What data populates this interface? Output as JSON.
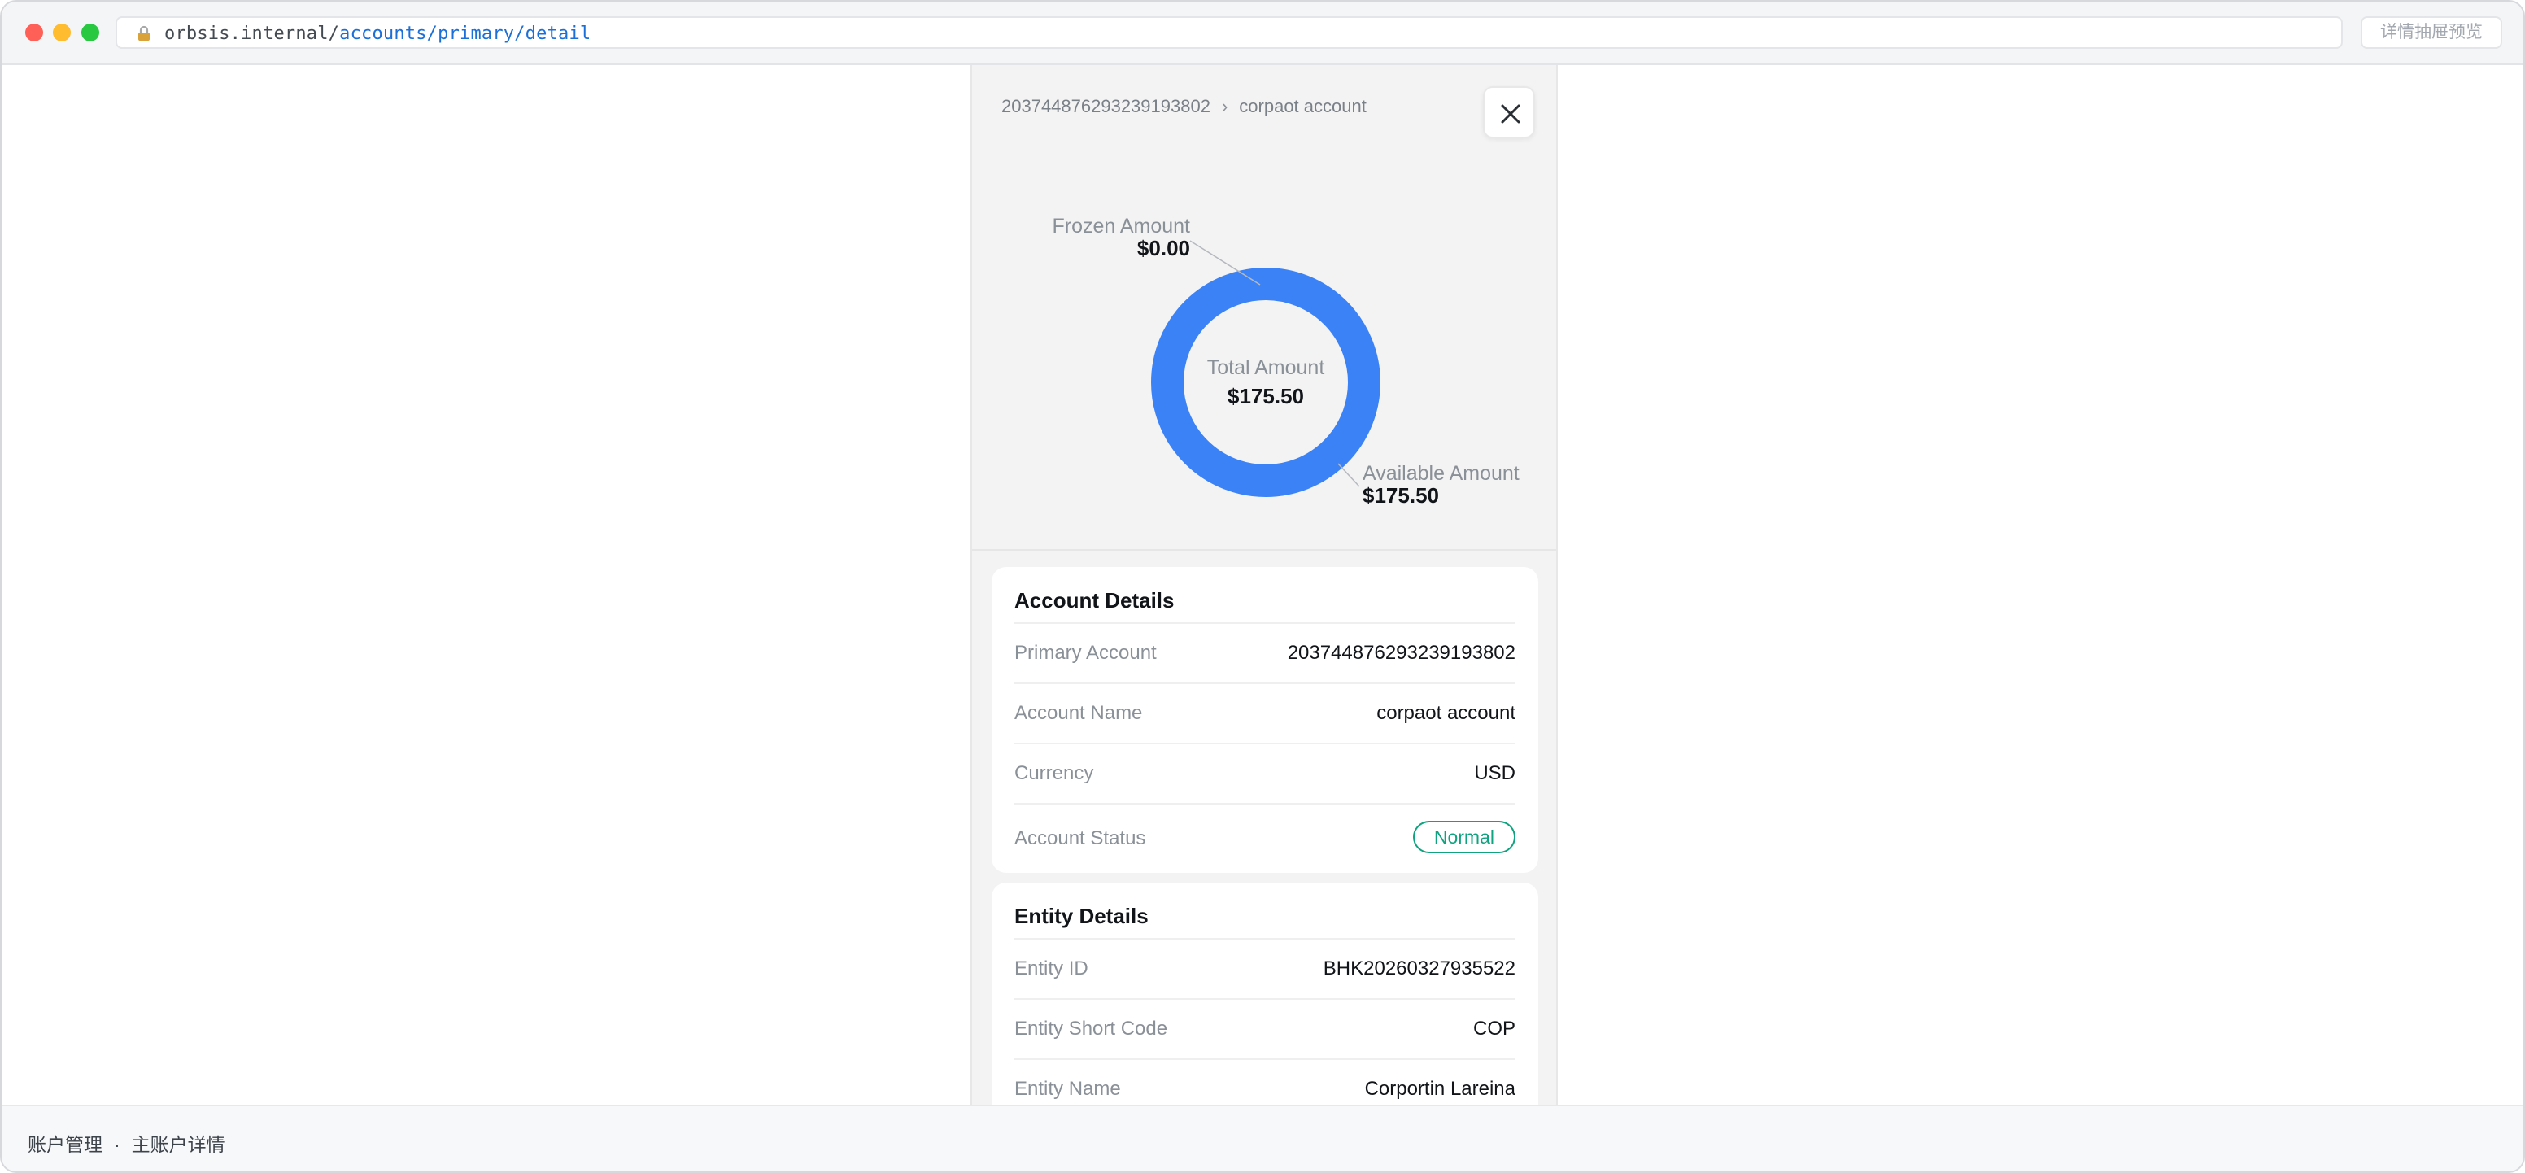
{
  "browser": {
    "url_host": "orbsis.internal/",
    "url_path": "accounts/primary/detail",
    "preview_button": "详情抽屉预览"
  },
  "drawer": {
    "breadcrumb": {
      "account_id": "203744876293239193802",
      "separator": "›",
      "account_name": "corpaot account"
    },
    "close_icon": "close-icon"
  },
  "chart_data": {
    "type": "pie",
    "variant": "donut",
    "center_label": "Total Amount",
    "center_value": "$175.50",
    "slices": [
      {
        "label": "Frozen Amount",
        "value": 0.0,
        "display": "$0.00",
        "color": "#3b82f6"
      },
      {
        "label": "Available Amount",
        "value": 175.5,
        "display": "$175.50",
        "color": "#3b82f6"
      }
    ],
    "ring_color": "#3b82f6"
  },
  "account_details": {
    "title": "Account Details",
    "rows": [
      {
        "label": "Primary Account",
        "value": "203744876293239193802"
      },
      {
        "label": "Account Name",
        "value": "corpaot account"
      },
      {
        "label": "Currency",
        "value": "USD"
      },
      {
        "label": "Account Status",
        "value": "Normal"
      }
    ],
    "status_color": "#10a37f"
  },
  "entity_details": {
    "title": "Entity Details",
    "rows": [
      {
        "label": "Entity ID",
        "value": "BHK20260327935522"
      },
      {
        "label": "Entity Short Code",
        "value": "COP"
      },
      {
        "label": "Entity Name",
        "value": "Corportin Lareina"
      }
    ]
  },
  "statusbar": {
    "section": "账户管理",
    "separator": "·",
    "page": "主账户详情"
  }
}
